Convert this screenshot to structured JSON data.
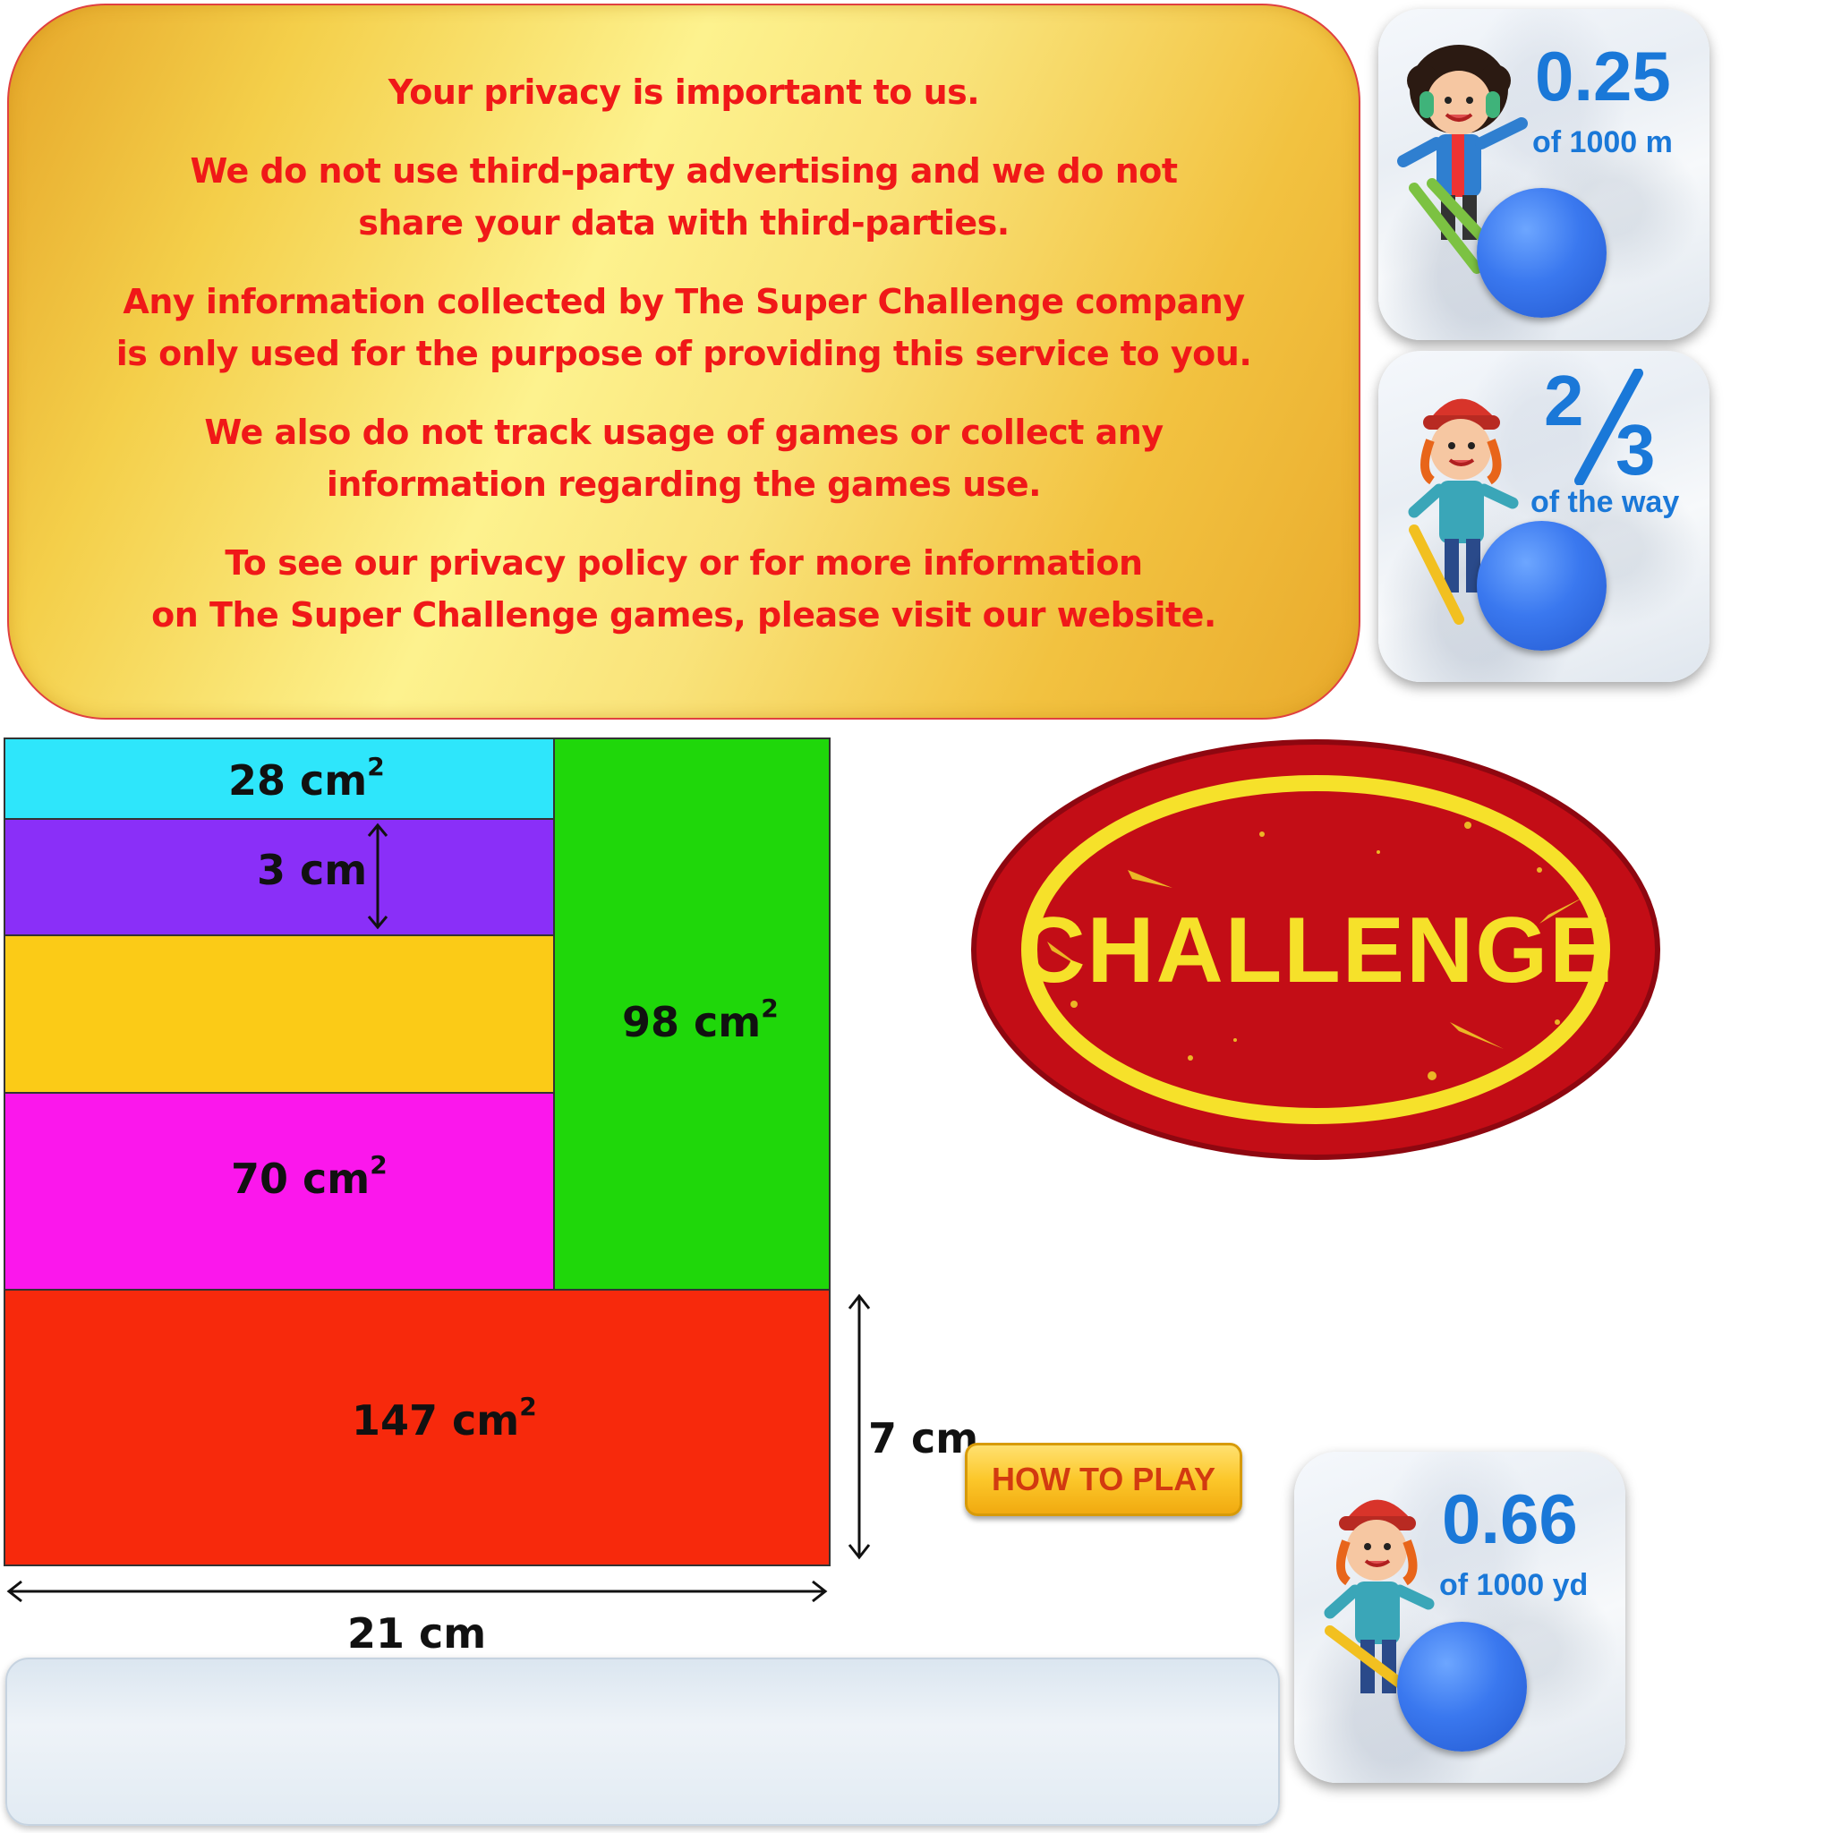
{
  "privacy": {
    "paragraphs": [
      [
        "Your privacy is important to us."
      ],
      [
        "We do not use third-party advertising and we do not",
        "share your data with third-parties."
      ],
      [
        "Any information collected by The Super Challenge company",
        "is only used for the purpose of providing this service to you."
      ],
      [
        "We also do not track usage of games or collect any",
        "information regarding the games use."
      ],
      [
        "To see our privacy policy or for more information",
        "on The Super Challenge games, please visit our website."
      ]
    ]
  },
  "cards": [
    {
      "value": "0.25",
      "unit": "of 1000 m",
      "skier": "girl-earmuffs"
    },
    {
      "fraction_numerator": "2",
      "fraction_denominator": "3",
      "unit": "of the way",
      "skier": "girl-red-hat"
    },
    {
      "value": "0.66",
      "unit": "of 1000 yd",
      "skier": "girl-red-hat"
    }
  ],
  "puzzle": {
    "cyan_area": "28 cm",
    "purple_height": "3 cm",
    "magenta_area": "70 cm",
    "green_area": "98 cm",
    "red_area": "147 cm",
    "squared": "2",
    "height_label": "7 cm",
    "width_label": "21 cm",
    "colors": {
      "cyan": "#2ee6fb",
      "purple": "#8a2ff8",
      "yellow": "#fbcb17",
      "magenta": "#fb17ec",
      "green": "#1fd70a",
      "red": "#f7290c"
    }
  },
  "badge": {
    "text": "CHALLENGE"
  },
  "howto": {
    "label": "HOW TO PLAY"
  },
  "answer": {
    "value": ""
  }
}
